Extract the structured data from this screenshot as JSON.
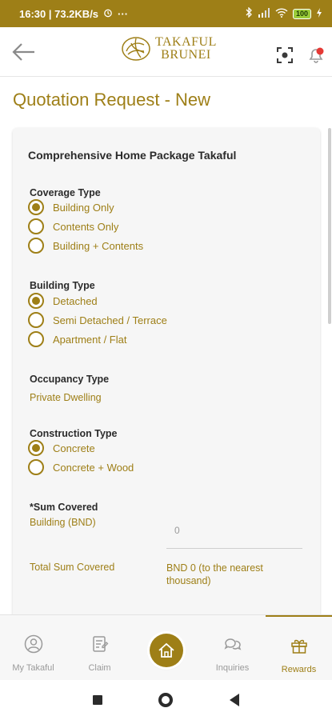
{
  "status_bar": {
    "time_speed": "16:30 | 73.2KB/s",
    "dots": "···",
    "battery": "100"
  },
  "header": {
    "logo_line1": "TAKAFUL",
    "logo_line2": "BRUNEI"
  },
  "page": {
    "title": "Quotation Request - New"
  },
  "form": {
    "product_title": "Comprehensive Home Package Takaful",
    "coverage": {
      "label": "Coverage Type",
      "options": [
        "Building Only",
        "Contents Only",
        "Building + Contents"
      ],
      "selected": "Building Only"
    },
    "building": {
      "label": "Building Type",
      "options": [
        "Detached",
        "Semi Detached / Terrace",
        "Apartment / Flat"
      ],
      "selected": "Detached"
    },
    "occupancy": {
      "label": "Occupancy Type",
      "value": "Private Dwelling"
    },
    "construction": {
      "label": "Construction Type",
      "options": [
        "Concrete",
        "Concrete + Wood"
      ],
      "selected": "Concrete"
    },
    "sum_covered": {
      "label": "*Sum Covered",
      "building_label": "Building (BND)",
      "building_value": "0"
    },
    "total": {
      "label": "Total Sum Covered",
      "value": "BND 0 (to the nearest thousand)"
    }
  },
  "bottom_nav": {
    "items": [
      {
        "label": "My Takaful",
        "icon": "user-circle-icon"
      },
      {
        "label": "Claim",
        "icon": "claim-document-icon"
      },
      {
        "label": "",
        "icon": "home-icon"
      },
      {
        "label": "Inquiries",
        "icon": "chat-bubbles-icon"
      },
      {
        "label": "Rewards",
        "icon": "gift-icon"
      }
    ],
    "active": "Rewards"
  },
  "colors": {
    "brand": "#9e7f17",
    "inactive": "#9a9a9a"
  }
}
